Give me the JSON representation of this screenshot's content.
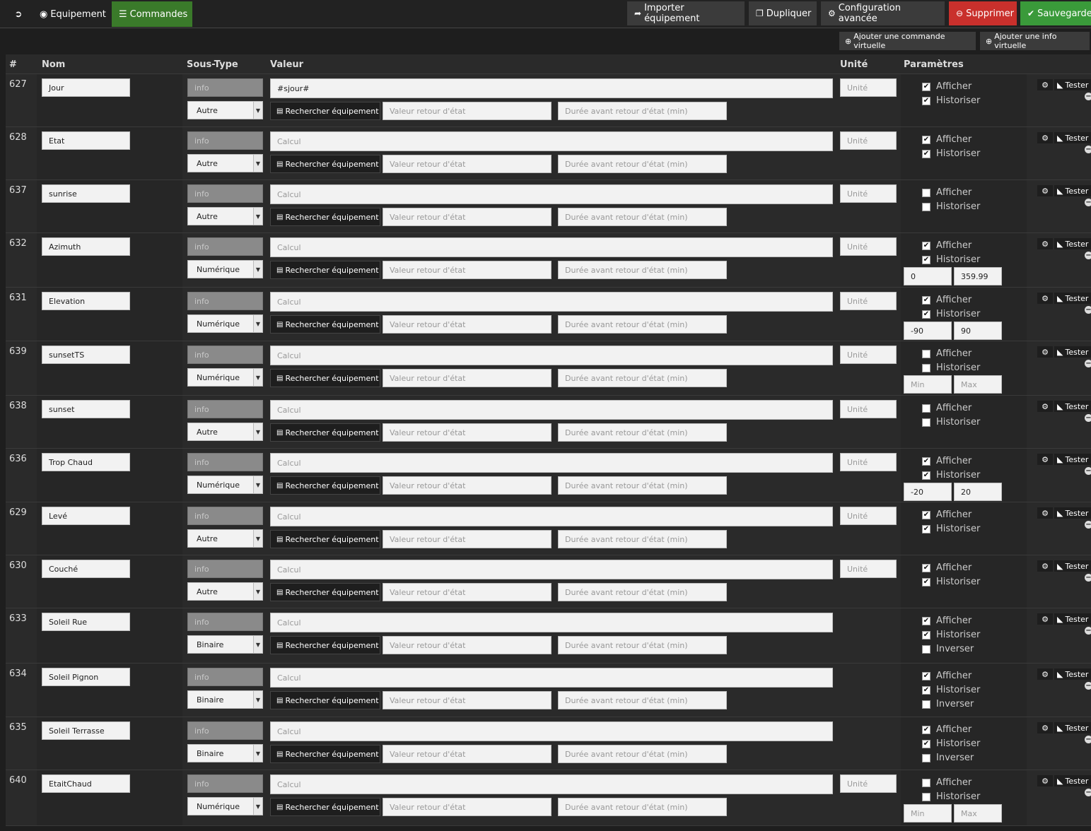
{
  "topbar": {
    "back_icon": "arrow-circle-left-icon",
    "tab_equipement": "Equipement",
    "tab_commandes": "Commandes",
    "btn_import": "Importer équipement",
    "btn_dupliquer": "Dupliquer",
    "btn_config": "Configuration avancée",
    "btn_supprimer": "Supprimer",
    "btn_sauvegarder": "Sauvegarder",
    "btn_add_cmd": "Ajouter une commande virtuelle",
    "btn_add_info": "Ajouter une info virtuelle"
  },
  "colors": {
    "green": "#3a9a3a",
    "red": "#c9302c",
    "tab_active": "#3a7a2a"
  },
  "table": {
    "headers": {
      "id": "#",
      "nom": "Nom",
      "soustype": "Sous-Type",
      "valeur": "Valeur",
      "unite": "Unité",
      "params": "Paramètres"
    },
    "placeholders": {
      "calcul": "Calcul",
      "unite": "Unité",
      "valeur_retour": "Valeur retour d'état",
      "duree": "Durée avant retour d'état (min)",
      "min": "Min",
      "max": "Max"
    },
    "labels": {
      "type": "info",
      "rechercher": "Rechercher équipement",
      "afficher": "Afficher",
      "historiser": "Historiser",
      "inverser": "Inverser",
      "tester": "Tester"
    },
    "rows": [
      {
        "id": "627",
        "nom": "Jour",
        "subtype": "Autre",
        "valeur": "#sjour#",
        "afficher": true,
        "historiser": true
      },
      {
        "id": "628",
        "nom": "Etat",
        "subtype": "Autre",
        "valeur": "",
        "afficher": true,
        "historiser": true
      },
      {
        "id": "637",
        "nom": "sunrise",
        "subtype": "Autre",
        "valeur": "",
        "afficher": false,
        "historiser": false
      },
      {
        "id": "632",
        "nom": "Azimuth",
        "subtype": "Numérique",
        "valeur": "",
        "afficher": true,
        "historiser": true,
        "min": "0",
        "max": "359.99"
      },
      {
        "id": "631",
        "nom": "Elevation",
        "subtype": "Numérique",
        "valeur": "",
        "afficher": true,
        "historiser": true,
        "min": "-90",
        "max": "90"
      },
      {
        "id": "639",
        "nom": "sunsetTS",
        "subtype": "Numérique",
        "valeur": "",
        "afficher": false,
        "historiser": false,
        "min": "",
        "max": ""
      },
      {
        "id": "638",
        "nom": "sunset",
        "subtype": "Autre",
        "valeur": "",
        "afficher": false,
        "historiser": false
      },
      {
        "id": "636",
        "nom": "Trop Chaud",
        "subtype": "Numérique",
        "valeur": "",
        "afficher": true,
        "historiser": true,
        "min": "-20",
        "max": "20"
      },
      {
        "id": "629",
        "nom": "Levé",
        "subtype": "Autre",
        "valeur": "",
        "afficher": true,
        "historiser": true
      },
      {
        "id": "630",
        "nom": "Couché",
        "subtype": "Autre",
        "valeur": "",
        "afficher": true,
        "historiser": true
      },
      {
        "id": "633",
        "nom": "Soleil Rue",
        "subtype": "Binaire",
        "valeur": "",
        "afficher": true,
        "historiser": true,
        "inverser": false
      },
      {
        "id": "634",
        "nom": "Soleil Pignon",
        "subtype": "Binaire",
        "valeur": "",
        "afficher": true,
        "historiser": true,
        "inverser": false
      },
      {
        "id": "635",
        "nom": "Soleil Terrasse",
        "subtype": "Binaire",
        "valeur": "",
        "afficher": true,
        "historiser": true,
        "inverser": false
      },
      {
        "id": "640",
        "nom": "EtaitChaud",
        "subtype": "Numérique",
        "valeur": "",
        "afficher": false,
        "historiser": false,
        "min": "",
        "max": ""
      }
    ]
  }
}
